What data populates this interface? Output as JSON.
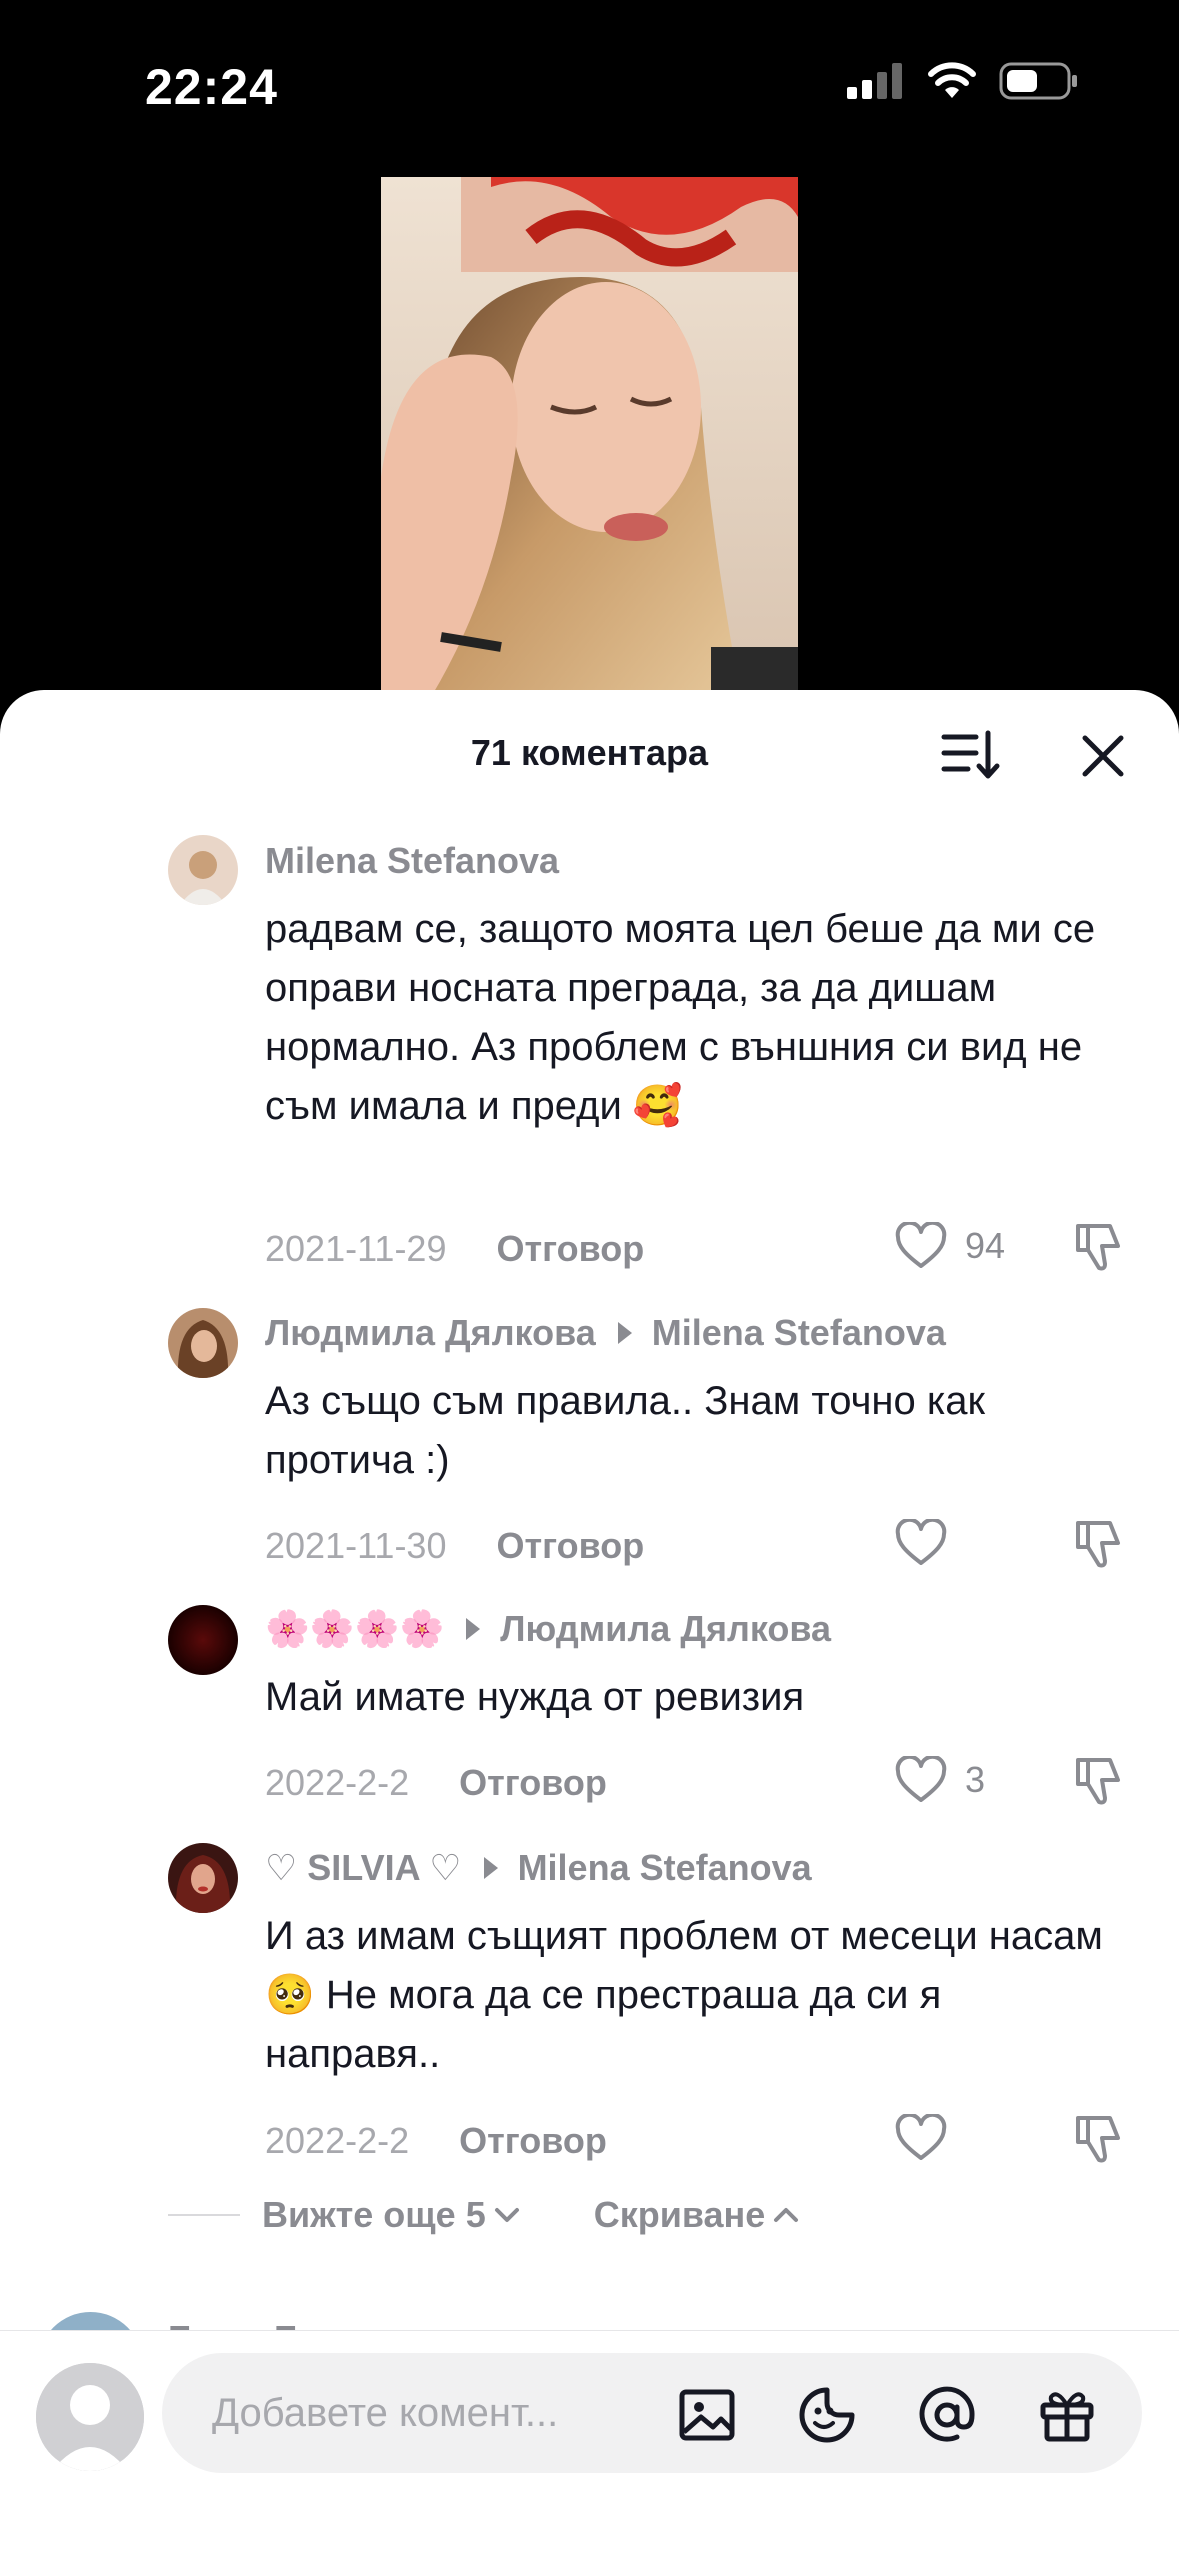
{
  "status_bar": {
    "time": "22:24"
  },
  "sheet": {
    "title": "71 коментара"
  },
  "comments": [
    {
      "author": "Milena Stefanova",
      "reply_to": "",
      "text": "радвам се, защото моята цел беше да ми се оправи носната преграда, за да дишам нормално. Аз проблем с външния си вид не съм имала и преди 🥰",
      "date": "2021-11-29",
      "reply_label": "Отговор",
      "likes": "94"
    },
    {
      "author": "Людмила Дялкова",
      "reply_to": "Milena Stefanova",
      "text": "Аз също съм правила.. Знам точно как протича :)",
      "date": "2021-11-30",
      "reply_label": "Отговор",
      "likes": ""
    },
    {
      "author": "🌸🌸🌸🌸",
      "reply_to": "Людмила Дялкова",
      "text": "Май имате нужда от ревизия",
      "date": "2022-2-2",
      "reply_label": "Отговор",
      "likes": "3"
    },
    {
      "author": "♡ SILVIA ♡",
      "reply_to": "Milena Stefanova",
      "text": "И аз имам същият проблем от месеци насам 🥺 Не мога да се престраша да си я направя..",
      "date": "2022-2-2",
      "reply_label": "Отговор",
      "likes": ""
    }
  ],
  "replies_controls": {
    "view_more": "Вижте още 5",
    "hide": "Скриване"
  },
  "next_comment": {
    "author": "Бъни Бънкова"
  },
  "composer": {
    "placeholder": "Добавете комент..."
  },
  "colors": {
    "text_primary": "#161823",
    "text_secondary": "#8a8b91",
    "background": "#ffffff"
  },
  "icons": [
    "signal-icon",
    "wifi-icon",
    "battery-icon",
    "sort-icon",
    "close-icon",
    "heart-icon",
    "dislike-icon",
    "chevron-down-icon",
    "chevron-up-icon",
    "image-icon",
    "emoji-icon",
    "mention-icon",
    "gift-icon"
  ]
}
